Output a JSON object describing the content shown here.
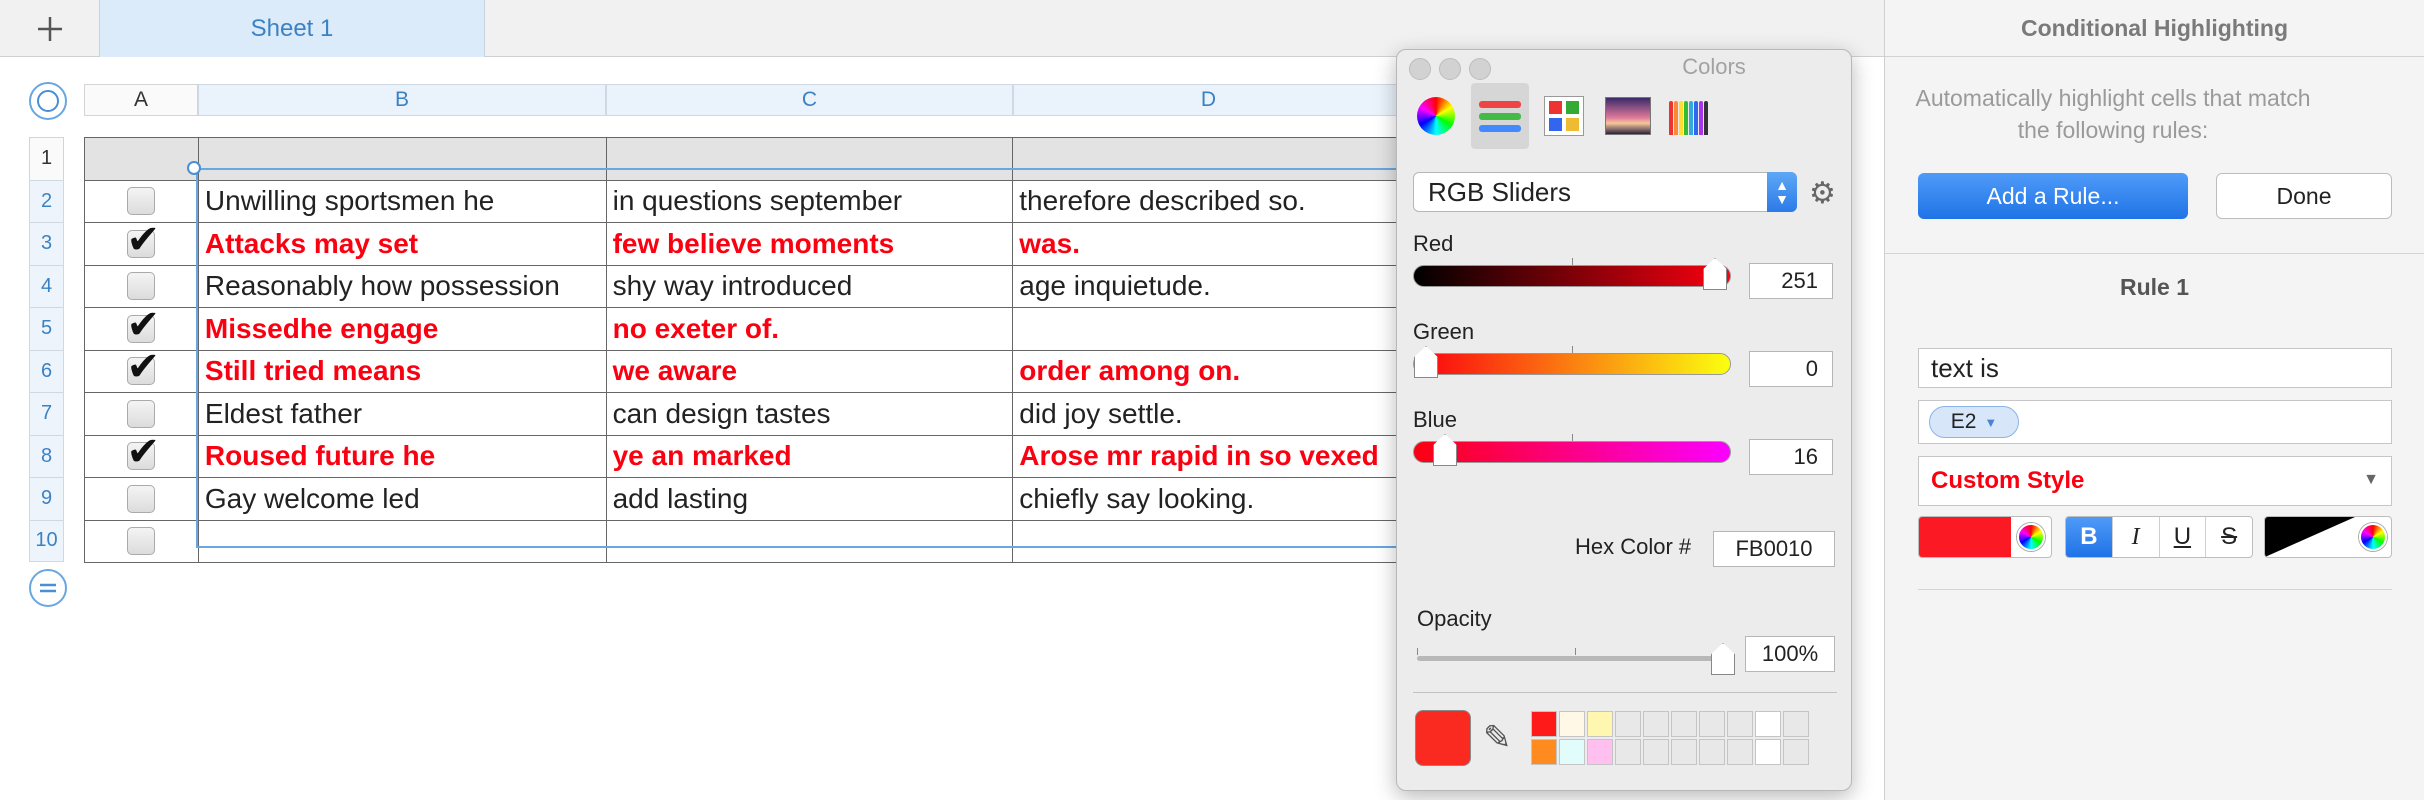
{
  "sheet": {
    "add_sheet_glyph": "+",
    "active_tab": "Sheet 1"
  },
  "table": {
    "columns": [
      "A",
      "B",
      "C",
      "D"
    ],
    "rows": [
      {
        "num": "1",
        "checked": null,
        "b": "",
        "c": "",
        "d": "",
        "highlighted": false
      },
      {
        "num": "2",
        "checked": false,
        "b": "Unwilling sportsmen he",
        "c": "in questions september",
        "d": "therefore described so.",
        "highlighted": false
      },
      {
        "num": "3",
        "checked": true,
        "b": "Attacks may set",
        "c": "few believe moments",
        "d": "was.",
        "highlighted": true
      },
      {
        "num": "4",
        "checked": false,
        "b": "Reasonably how possession",
        "c": "shy way introduced",
        "d": "age inquietude.",
        "highlighted": false
      },
      {
        "num": "5",
        "checked": true,
        "b": "Missedhe engage",
        "c": "no exeter of.",
        "d": "",
        "highlighted": true
      },
      {
        "num": "6",
        "checked": true,
        "b": "Still tried means",
        "c": "we aware",
        "d": "order among on.",
        "highlighted": true
      },
      {
        "num": "7",
        "checked": false,
        "b": "Eldest father",
        "c": "can design tastes",
        "d": "did joy settle.",
        "highlighted": false
      },
      {
        "num": "8",
        "checked": true,
        "b": "Roused future he",
        "c": "ye an marked",
        "d": "Arose mr rapid in so vexed",
        "highlighted": true
      },
      {
        "num": "9",
        "checked": false,
        "b": "Gay welcome led",
        "c": "add lasting",
        "d": "chiefly say looking.",
        "highlighted": false
      },
      {
        "num": "10",
        "checked": false,
        "b": "",
        "c": "",
        "d": "",
        "highlighted": false
      }
    ]
  },
  "colors_panel": {
    "title": "Colors",
    "modes": [
      "color-wheel-icon",
      "color-sliders-icon",
      "color-palettes-icon",
      "image-palettes-icon",
      "pencils-icon"
    ],
    "slider_mode": "RGB Sliders",
    "sliders": {
      "red": {
        "label": "Red",
        "value": "251",
        "fraction": 0.984
      },
      "green": {
        "label": "Green",
        "value": "0",
        "fraction": 0.0
      },
      "blue": {
        "label": "Blue",
        "value": "16",
        "fraction": 0.063
      }
    },
    "hex_label": "Hex Color #",
    "hex_value": "FB0010",
    "opacity_label": "Opacity",
    "opacity_value": "100%",
    "opacity_fraction": 1.0,
    "current_color": "#fb2a20",
    "swatches_row1": [
      "#ff1a1a",
      "#fff8e6",
      "#fff6b0",
      "#e8e8e8",
      "#e8e8e8",
      "#e8e8e8",
      "#e8e8e8",
      "#e8e8e8",
      "#ffffff",
      "#e8e8e8"
    ],
    "swatches_row2": [
      "#ff8a1f",
      "#e2fbfb",
      "#ffc0f0",
      "#e8e8e8",
      "#e8e8e8",
      "#e8e8e8",
      "#e8e8e8",
      "#e8e8e8",
      "#ffffff",
      "#e8e8e8"
    ]
  },
  "inspector": {
    "title": "Conditional Highlighting",
    "description": "Automatically highlight cells that match the following rules:",
    "add_rule_label": "Add a Rule...",
    "done_label": "Done",
    "rule_title": "Rule 1",
    "condition": "text is",
    "token": "E2",
    "style": "Custom Style",
    "fill_color": "#fb1a24",
    "text_color": "#000000",
    "format_buttons": {
      "bold": "B",
      "italic": "I",
      "underline": "U",
      "strike": "S"
    },
    "bold_on": true
  },
  "colors": {
    "accent": "#3b82c4",
    "highlight_text": "#fb0010"
  }
}
